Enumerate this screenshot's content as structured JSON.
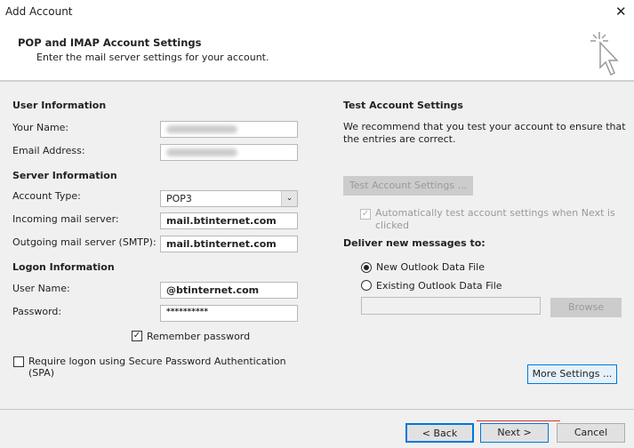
{
  "window": {
    "title": "Add Account",
    "close": "✕"
  },
  "header": {
    "title": "POP and IMAP Account Settings",
    "subtitle": "Enter the mail server settings for your account."
  },
  "user_info": {
    "heading": "User Information",
    "name_label": "Your Name:",
    "email_label": "Email Address:"
  },
  "server_info": {
    "heading": "Server Information",
    "account_type_label": "Account Type:",
    "account_type": "POP3",
    "incoming_label": "Incoming mail server:",
    "incoming": "mail.btinternet.com",
    "outgoing_label": "Outgoing mail server (SMTP):",
    "outgoing": "mail.btinternet.com"
  },
  "logon_info": {
    "heading": "Logon Information",
    "username_label": "User Name:",
    "username": "@btinternet.com",
    "password_label": "Password:",
    "password": "**********",
    "remember_label": "Remember password",
    "remember_checked": true,
    "spa_label": "Require logon using Secure Password Authentication (SPA)",
    "spa_checked": false
  },
  "test": {
    "heading": "Test Account Settings",
    "description": "We recommend that you test your account to ensure that the entries are correct.",
    "button": "Test Account Settings ...",
    "auto_label": "Automatically test account settings when Next is clicked",
    "auto_checked": true
  },
  "deliver": {
    "heading": "Deliver new messages to:",
    "option_new": "New Outlook Data File",
    "option_existing": "Existing Outlook Data File",
    "selected": "New Outlook Data File",
    "browse": "Browse"
  },
  "more_settings": "More Settings ...",
  "footer": {
    "back": "< Back",
    "next": "Next >",
    "cancel": "Cancel"
  }
}
